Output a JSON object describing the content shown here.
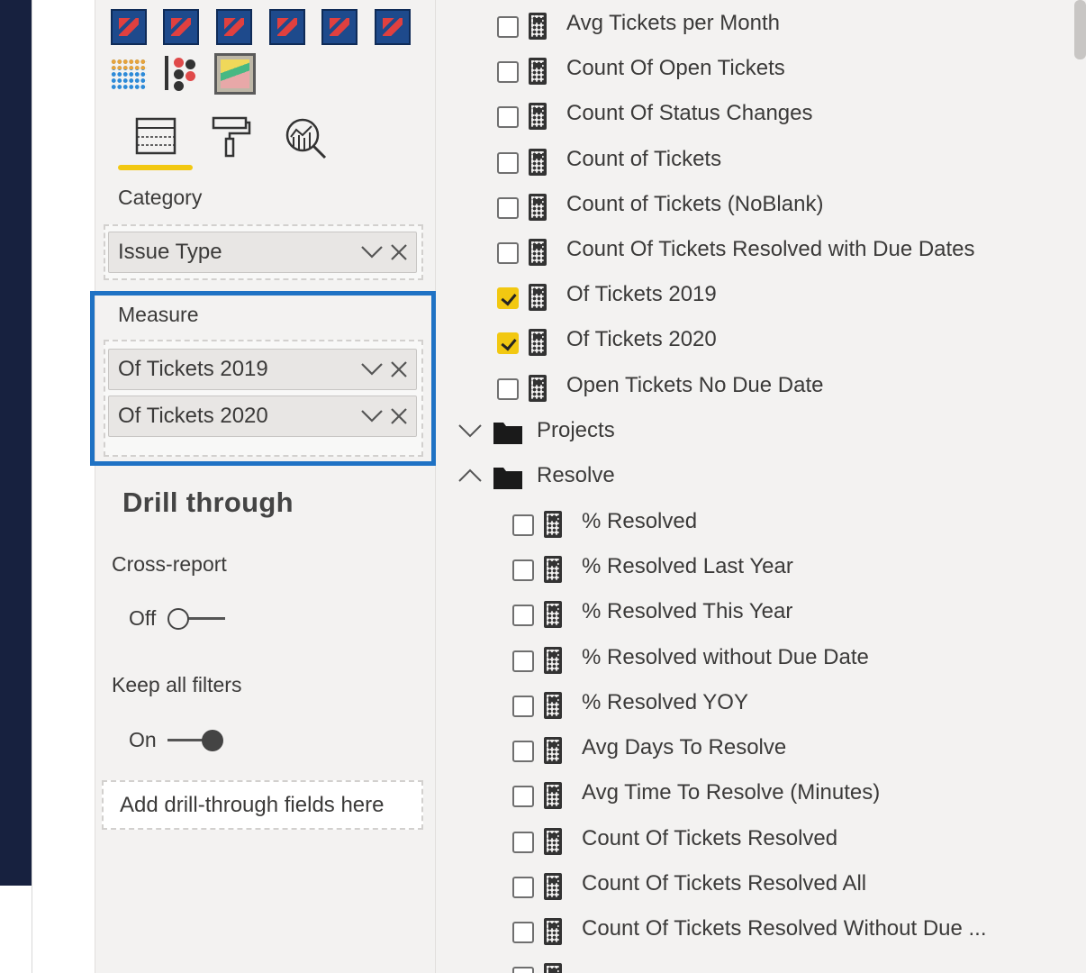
{
  "visual_pane": {
    "tabs": [
      {
        "name": "fields",
        "icon": "fields-icon",
        "active": true
      },
      {
        "name": "format",
        "icon": "paint-roller-icon",
        "active": false
      },
      {
        "name": "analytics",
        "icon": "analytics-magnifier-icon",
        "active": false
      }
    ],
    "category_label": "Category",
    "category_fields": [
      "Issue Type"
    ],
    "measure_label": "Measure",
    "measure_fields": [
      "Of Tickets 2019",
      "Of Tickets 2020"
    ],
    "drill_through": {
      "title": "Drill through",
      "cross_report_label": "Cross-report",
      "cross_report_state": "Off",
      "keep_filters_label": "Keep all filters",
      "keep_filters_state": "On",
      "drop_placeholder": "Add drill-through fields here"
    },
    "accent_color": "#f2c811",
    "highlight_color": "#1f72c4"
  },
  "fields_pane": {
    "measures_top": [
      {
        "label": "Avg Tickets per Month",
        "checked": false
      },
      {
        "label": "Count Of Open Tickets",
        "checked": false
      },
      {
        "label": "Count Of Status Changes",
        "checked": false
      },
      {
        "label": "Count of Tickets",
        "checked": false
      },
      {
        "label": "Count of Tickets (NoBlank)",
        "checked": false
      },
      {
        "label": "Count Of Tickets Resolved with Due Dates",
        "checked": false
      },
      {
        "label": "Of Tickets 2019",
        "checked": true
      },
      {
        "label": "Of Tickets 2020",
        "checked": true
      },
      {
        "label": "Open Tickets No Due Date",
        "checked": false
      }
    ],
    "folders": [
      {
        "label": "Projects",
        "expanded": false
      },
      {
        "label": "Resolve",
        "expanded": true
      }
    ],
    "resolve_measures": [
      {
        "label": "% Resolved",
        "checked": false
      },
      {
        "label": "% Resolved Last Year",
        "checked": false
      },
      {
        "label": "% Resolved This Year",
        "checked": false
      },
      {
        "label": "% Resolved without Due Date",
        "checked": false
      },
      {
        "label": "% Resolved YOY",
        "checked": false
      },
      {
        "label": "Avg Days To Resolve",
        "checked": false
      },
      {
        "label": "Avg Time To Resolve (Minutes)",
        "checked": false
      },
      {
        "label": "Count Of Tickets Resolved",
        "checked": false
      },
      {
        "label": "Count Of Tickets Resolved All",
        "checked": false
      },
      {
        "label": "Count Of Tickets Resolved Without Due ...",
        "checked": false
      }
    ]
  }
}
